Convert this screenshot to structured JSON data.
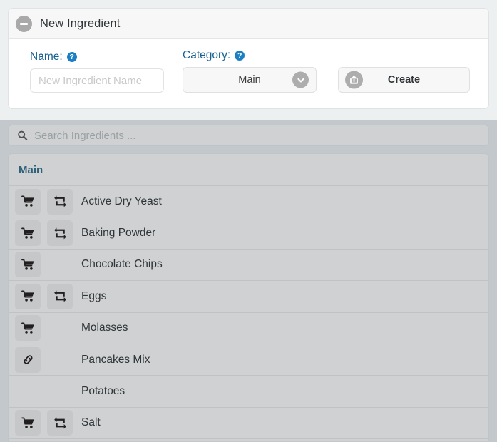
{
  "panel": {
    "title": "New Ingredient",
    "collapse_icon": "minus-circle-icon",
    "name_field": {
      "label": "Name:",
      "help_icon": "?",
      "value": "",
      "placeholder": "New Ingredient Name"
    },
    "category_field": {
      "label": "Category:",
      "help_icon": "?",
      "selected": "Main",
      "options": [
        "Main"
      ],
      "chevron_icon": "chevron-down-icon"
    },
    "create_button": {
      "label": "Create",
      "icon": "share-export-icon"
    }
  },
  "search": {
    "icon": "search-icon",
    "value": "",
    "placeholder": "Search Ingredients ..."
  },
  "list": {
    "group_header": "Main",
    "rows": [
      {
        "label": "Active Dry Yeast",
        "icons": [
          "cart-icon",
          "exchange-icon"
        ]
      },
      {
        "label": "Baking Powder",
        "icons": [
          "cart-icon",
          "exchange-icon"
        ]
      },
      {
        "label": "Chocolate Chips",
        "icons": [
          "cart-icon"
        ]
      },
      {
        "label": "Eggs",
        "icons": [
          "cart-icon",
          "exchange-icon"
        ]
      },
      {
        "label": "Molasses",
        "icons": [
          "cart-icon"
        ]
      },
      {
        "label": "Pancakes Mix",
        "icons": [
          "link-icon"
        ]
      },
      {
        "label": "Potatoes",
        "icons": []
      },
      {
        "label": "Salt",
        "icons": [
          "cart-icon",
          "exchange-icon"
        ]
      }
    ]
  },
  "colors": {
    "page_background": "#ecf0f1",
    "panel_background": "#ffffff",
    "lower_background": "#c2c8cc",
    "list_background": "#cfd1d2",
    "label_blue": "#186090",
    "help_blue": "#1b7fc4",
    "group_header_text": "#2d6179",
    "icon_button_grey": "#adadad"
  }
}
